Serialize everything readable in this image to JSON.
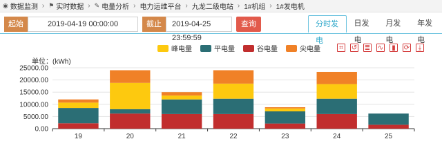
{
  "breadcrumb": [
    {
      "icon": "eye-icon",
      "glyph": "◉",
      "label": "数据监测"
    },
    {
      "icon": "flag-icon",
      "glyph": "⚑",
      "label": "实时数据"
    },
    {
      "icon": "wrench-icon",
      "glyph": "✎",
      "label": "电量分析"
    },
    {
      "label": "电力运维平台"
    },
    {
      "label": "九龙二级电站"
    },
    {
      "label": "1#机组"
    },
    {
      "label": "1#发电机"
    }
  ],
  "filter": {
    "start_label": "起始",
    "start_value": "2019-04-19 00:00:00",
    "end_label": "截止",
    "end_value": "2019-04-25 23:59:59",
    "query_label": "查询"
  },
  "tabs": [
    "分时发电",
    "日发电",
    "月发电",
    "年发电"
  ],
  "active_tab": "分时发电",
  "unit_label": "单位：(kWh)",
  "colors": {
    "peak": "#fdc90f",
    "flat": "#2b6e75",
    "valley": "#c12e2e",
    "sharp": "#f08127"
  },
  "tools": [
    "rectangle-zoom-icon",
    "zoom-reset-icon",
    "data-view-icon",
    "line-chart-icon",
    "bar-chart-icon",
    "refresh-icon",
    "download-icon"
  ],
  "chart_data": {
    "type": "bar",
    "stacked": true,
    "categories": [
      "19",
      "20",
      "21",
      "22",
      "23",
      "24",
      "25"
    ],
    "series": [
      {
        "name": "谷电量",
        "color": "#c12e2e",
        "values": [
          2200,
          6200,
          6000,
          6000,
          2100,
          6000,
          1600
        ]
      },
      {
        "name": "平电量",
        "color": "#2b6e75",
        "values": [
          6300,
          1800,
          6000,
          6300,
          5000,
          6300,
          4600
        ]
      },
      {
        "name": "峰电量",
        "color": "#fdc90f",
        "values": [
          2200,
          10800,
          1600,
          6200,
          1200,
          6000,
          0
        ]
      },
      {
        "name": "尖电量",
        "color": "#f08127",
        "values": [
          1300,
          5200,
          1400,
          5500,
          500,
          5000,
          0
        ]
      }
    ],
    "legend_order": [
      "峰电量",
      "平电量",
      "谷电量",
      "尖电量"
    ],
    "ylim": [
      0,
      25000
    ],
    "yticks": [
      "0.00",
      "5000.00",
      "10000.00",
      "15000.00",
      "20000.00",
      "25000.00"
    ],
    "ylabel": "单位：(kWh)",
    "grid": true,
    "legend_position": "top-center"
  }
}
